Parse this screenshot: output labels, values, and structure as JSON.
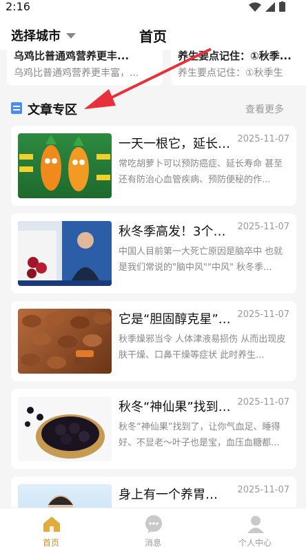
{
  "status": {
    "time": "2:16"
  },
  "header": {
    "city_label": "选择城市",
    "title": "首页"
  },
  "top_cards": [
    {
      "title": "乌鸡比普通鸡营养更丰...",
      "subtitle": "乌鸡比普通鸡营养更丰富，..."
    },
    {
      "title": "养生要点记住：①秋季...",
      "subtitle": "养生要点记住：①秋季生"
    }
  ],
  "section": {
    "title": "文章专区",
    "more": "查看更多"
  },
  "articles": [
    {
      "title": "一天一根它，延长寿命…",
      "date": "2025-11-07",
      "desc": "常吃胡萝卜可以预防癌症、延长寿命 甚至还有防治心血管疾病、预防便秘的作..."
    },
    {
      "title": "秋冬季高发！3个…",
      "date": "2025-11-07",
      "desc": "中国人目前第一大死亡原因是脑卒中 也就是我们常说的\"脑中风\"\"中风\" 秋冬季..."
    },
    {
      "title": "它是“胆固醇克星”…",
      "date": "2025-11-07",
      "desc": "秋季燥邪当令 人体津液易损伤 从而出现皮肤干燥、口鼻干燥等症状 此时养生..."
    },
    {
      "title": "秋冬“神仙果”找到…",
      "date": "2025-11-07",
      "desc": "秋冬“神仙果”找到了，让你气血足、睡得好、不显老～叶子也是宝，血压血糖都..."
    },
    {
      "title": "身上有一个养胃…",
      "date": "2025-11-07",
      "desc": ""
    }
  ],
  "bottom_nav": [
    {
      "label": "首页",
      "icon": "home-icon",
      "active": true
    },
    {
      "label": "消息",
      "icon": "message-icon",
      "active": false
    },
    {
      "label": "个人中心",
      "icon": "profile-icon",
      "active": false
    }
  ],
  "colors": {
    "accent": "#c48f2a",
    "arrow": "#e8303a",
    "section_icon": "#4a8cf0"
  }
}
